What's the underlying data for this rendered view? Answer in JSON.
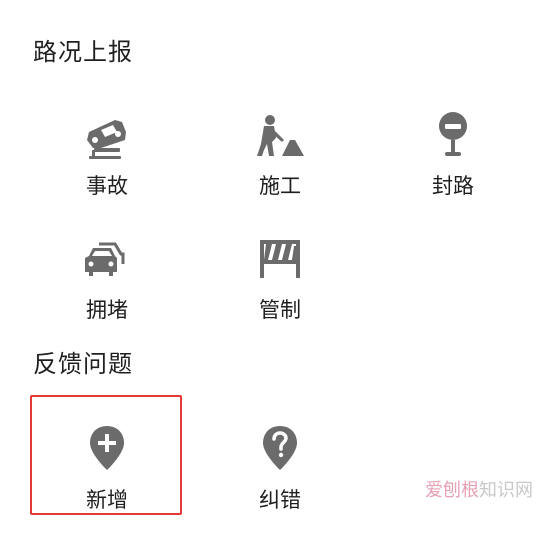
{
  "sections": {
    "road_report": {
      "title": "路况上报",
      "items": [
        {
          "label": "事故",
          "icon": "car-crash-icon"
        },
        {
          "label": "施工",
          "icon": "construction-worker-icon"
        },
        {
          "label": "封路",
          "icon": "road-closed-icon"
        },
        {
          "label": "拥堵",
          "icon": "traffic-jam-icon"
        },
        {
          "label": "管制",
          "icon": "barrier-icon"
        }
      ]
    },
    "feedback": {
      "title": "反馈问题",
      "items": [
        {
          "label": "新增",
          "icon": "add-pin-icon"
        },
        {
          "label": "纠错",
          "icon": "question-pin-icon"
        }
      ]
    }
  },
  "watermark": {
    "part1": "爱刨根",
    "part2": "知识网"
  },
  "colors": {
    "icon": "#6b6b6b",
    "text": "#1f1f1f",
    "highlight": "#e53935"
  }
}
